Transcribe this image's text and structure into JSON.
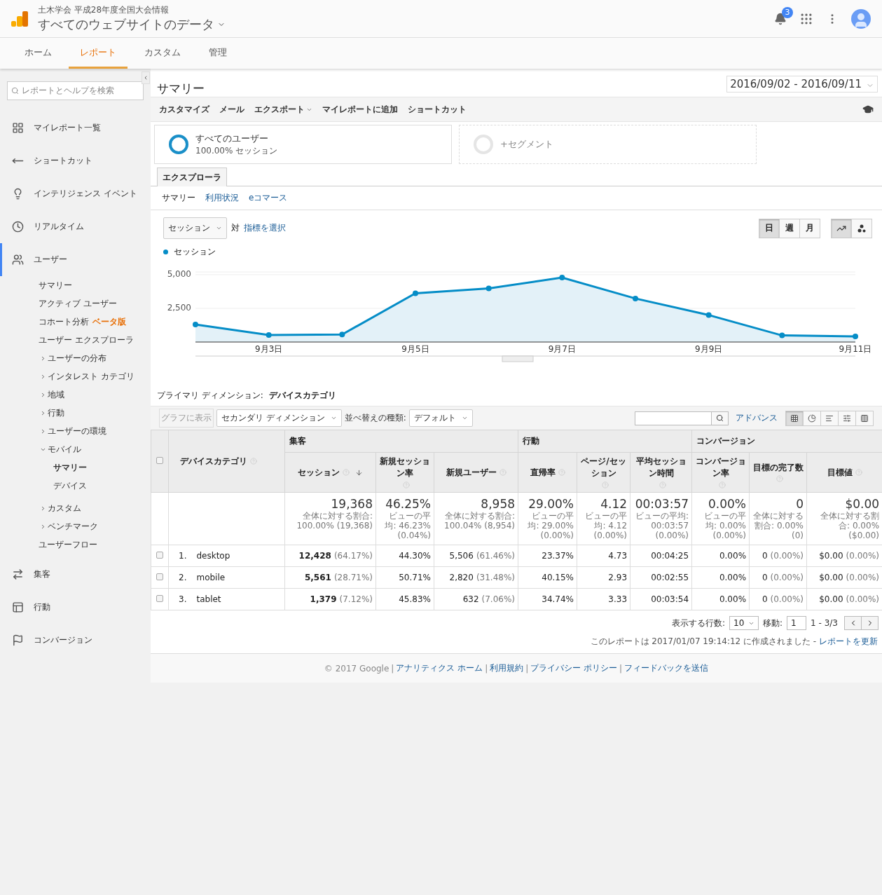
{
  "header": {
    "account": "土木学会 平成28年度全国大会情報",
    "property": "すべてのウェブサイトのデータ",
    "notifications": "3"
  },
  "nav": [
    {
      "label": "ホーム",
      "selected": false
    },
    {
      "label": "レポート",
      "selected": true
    },
    {
      "label": "カスタム",
      "selected": false
    },
    {
      "label": "管理",
      "selected": false
    }
  ],
  "sidebar": {
    "search_placeholder": "レポートとヘルプを検索",
    "items": [
      {
        "label": "マイレポート一覧",
        "selected": false
      },
      {
        "label": "ショートカット",
        "selected": false
      },
      {
        "label": "インテリジェンス イベント",
        "selected": false
      },
      {
        "label": "リアルタイム",
        "selected": false
      },
      {
        "label": "ユーザー",
        "selected": true,
        "children": [
          {
            "label": "サマリー",
            "kind": "link",
            "selected": false
          },
          {
            "label": "アクティブ ユーザー",
            "kind": "link",
            "selected": false
          },
          {
            "label": "コホート分析",
            "kind": "link",
            "selected": false,
            "badge": "ベータ版"
          },
          {
            "label": "ユーザー エクスプローラ",
            "kind": "link",
            "selected": false
          },
          {
            "label": "ユーザーの分布",
            "kind": "folder",
            "expanded": false
          },
          {
            "label": "インタレスト カテゴリ",
            "kind": "folder",
            "expanded": false
          },
          {
            "label": "地域",
            "kind": "folder",
            "expanded": false
          },
          {
            "label": "行動",
            "kind": "folder",
            "expanded": false
          },
          {
            "label": "ユーザーの環境",
            "kind": "folder",
            "expanded": false
          },
          {
            "label": "モバイル",
            "kind": "folder",
            "expanded": true,
            "children": [
              {
                "label": "サマリー",
                "selected": true
              },
              {
                "label": "デバイス",
                "selected": false
              }
            ]
          },
          {
            "label": "カスタム",
            "kind": "folder",
            "expanded": false
          },
          {
            "label": "ベンチマーク",
            "kind": "folder",
            "expanded": false
          },
          {
            "label": "ユーザーフロー",
            "kind": "link",
            "selected": false
          }
        ]
      },
      {
        "label": "集客",
        "selected": false
      },
      {
        "label": "行動",
        "selected": false
      },
      {
        "label": "コンバージョン",
        "selected": false
      }
    ]
  },
  "report": {
    "title": "サマリー",
    "date_range": "2016/09/02 - 2016/09/11",
    "toolbar": [
      {
        "label": "カスタマイズ",
        "menu": false
      },
      {
        "label": "メール",
        "menu": false
      },
      {
        "label": "エクスポート",
        "menu": true
      },
      {
        "label": "マイレポートに追加",
        "menu": false
      },
      {
        "label": "ショートカット",
        "menu": false
      }
    ],
    "segments": [
      {
        "kind": "active",
        "title": "すべてのユーザー",
        "subtitle": "100.00% セッション"
      },
      {
        "kind": "add",
        "title": "+セグメント"
      }
    ],
    "explorer_tab": "エクスプローラ",
    "subtabs": [
      {
        "label": "サマリー",
        "selected": true
      },
      {
        "label": "利用状況",
        "selected": false
      },
      {
        "label": "eコマース",
        "selected": false
      }
    ],
    "metric_select": "セッション",
    "versus": "対",
    "metric_link": "指標を選択",
    "periods": [
      {
        "label": "日",
        "selected": true
      },
      {
        "label": "週",
        "selected": false
      },
      {
        "label": "月",
        "selected": false
      }
    ],
    "chart_types": [
      {
        "selected": true
      },
      {
        "selected": false
      }
    ],
    "chart_data": {
      "type": "area",
      "categories": [
        null,
        "9月3日",
        null,
        "9月5日",
        null,
        "9月7日",
        null,
        "9月9日",
        null,
        "9月11日"
      ],
      "series": [
        {
          "name": "セッション",
          "color": "#058dc7",
          "values": [
            1300,
            520,
            560,
            3620,
            3980,
            4780,
            3230,
            2000,
            490,
            420
          ]
        }
      ],
      "yticks": [
        {
          "value": 2500,
          "label": "2,500"
        },
        {
          "value": 5000,
          "label": "5,000"
        }
      ],
      "ylim": [
        0,
        5200
      ]
    },
    "primary_dimension_label": "プライマリ ディメンション:",
    "primary_dimension": "デバイスカテゴリ",
    "table_tools": {
      "plot": "グラフに表示",
      "secondary": "セカンダリ ディメンション",
      "sort_label": "並べ替えの種類:",
      "sort": "デフォルト",
      "advanced": "アドバンス",
      "views": [
        {
          "selected": true
        },
        {
          "selected": false
        },
        {
          "selected": false
        },
        {
          "selected": false
        },
        {
          "selected": false
        }
      ]
    },
    "table": {
      "select_all_checked": false,
      "dimension": "デバイスカテゴリ",
      "groups": [
        "集客",
        "行動",
        "コンバージョン"
      ],
      "columns": [
        {
          "label": "セッション",
          "sorted": true
        },
        {
          "label": "新規セッション率",
          "sorted": false
        },
        {
          "label": "新規ユーザー",
          "sorted": false
        },
        {
          "label": "直帰率",
          "sorted": false
        },
        {
          "label": "ページ/セッション",
          "sorted": false
        },
        {
          "label": "平均セッション時間",
          "sorted": false
        },
        {
          "label": "コンバージョン率",
          "sorted": false
        },
        {
          "label": "目標の完了数",
          "sorted": false
        },
        {
          "label": "目標値",
          "sorted": false
        }
      ],
      "totals": [
        {
          "value": "19,368",
          "note": "全体に対する割合: 100.00% (19,368)"
        },
        {
          "value": "46.25%",
          "note": "ビューの平均: 46.23% (0.04%)"
        },
        {
          "value": "8,958",
          "note": "全体に対する割合: 100.04% (8,954)"
        },
        {
          "value": "29.00%",
          "note": "ビューの平均: 29.00% (0.00%)"
        },
        {
          "value": "4.12",
          "note": "ビューの平均: 4.12 (0.00%)"
        },
        {
          "value": "00:03:57",
          "note": "ビューの平均: 00:03:57 (0.00%)"
        },
        {
          "value": "0.00%",
          "note": "ビューの平均: 0.00% (0.00%)"
        },
        {
          "value": "0",
          "note": "全体に対する割合: 0.00% (0)"
        },
        {
          "value": "$0.00",
          "note": "全体に対する割合: 0.00% ($0.00)"
        }
      ],
      "rows": [
        {
          "index": "1.",
          "name": "desktop",
          "checked": false,
          "cells": [
            {
              "value": "12,428",
              "pct": "(64.17%)"
            },
            {
              "value": "44.30%"
            },
            {
              "value": "5,506",
              "pct": "(61.46%)"
            },
            {
              "value": "23.37%"
            },
            {
              "value": "4.73"
            },
            {
              "value": "00:04:25"
            },
            {
              "value": "0.00%"
            },
            {
              "value": "0",
              "pct": "(0.00%)"
            },
            {
              "value": "$0.00",
              "pct": "(0.00%)"
            }
          ]
        },
        {
          "index": "2.",
          "name": "mobile",
          "checked": false,
          "cells": [
            {
              "value": "5,561",
              "pct": "(28.71%)"
            },
            {
              "value": "50.71%"
            },
            {
              "value": "2,820",
              "pct": "(31.48%)"
            },
            {
              "value": "40.15%"
            },
            {
              "value": "2.93"
            },
            {
              "value": "00:02:55"
            },
            {
              "value": "0.00%"
            },
            {
              "value": "0",
              "pct": "(0.00%)"
            },
            {
              "value": "$0.00",
              "pct": "(0.00%)"
            }
          ]
        },
        {
          "index": "3.",
          "name": "tablet",
          "checked": false,
          "cells": [
            {
              "value": "1,379",
              "pct": "(7.12%)"
            },
            {
              "value": "45.83%"
            },
            {
              "value": "632",
              "pct": "(7.06%)"
            },
            {
              "value": "34.74%"
            },
            {
              "value": "3.33"
            },
            {
              "value": "00:03:54"
            },
            {
              "value": "0.00%"
            },
            {
              "value": "0",
              "pct": "(0.00%)"
            },
            {
              "value": "$0.00",
              "pct": "(0.00%)"
            }
          ]
        }
      ]
    },
    "pagination": {
      "rows_label": "表示する行数:",
      "rows": "10",
      "goto_label": "移動:",
      "goto": "1",
      "range": "1 - 3/3"
    },
    "generated": "このレポートは 2017/01/07 19:14:12 に作成されました - ",
    "refresh": "レポートを更新"
  },
  "footer": {
    "separator": "|",
    "items": [
      {
        "text": "© 2017 Google",
        "kind": "text"
      },
      {
        "text": "アナリティクス ホーム",
        "kind": "link"
      },
      {
        "text": "利用規約",
        "kind": "link"
      },
      {
        "text": "プライバシー ポリシー",
        "kind": "link"
      },
      {
        "text": "フィードバックを送信",
        "kind": "link"
      }
    ]
  }
}
